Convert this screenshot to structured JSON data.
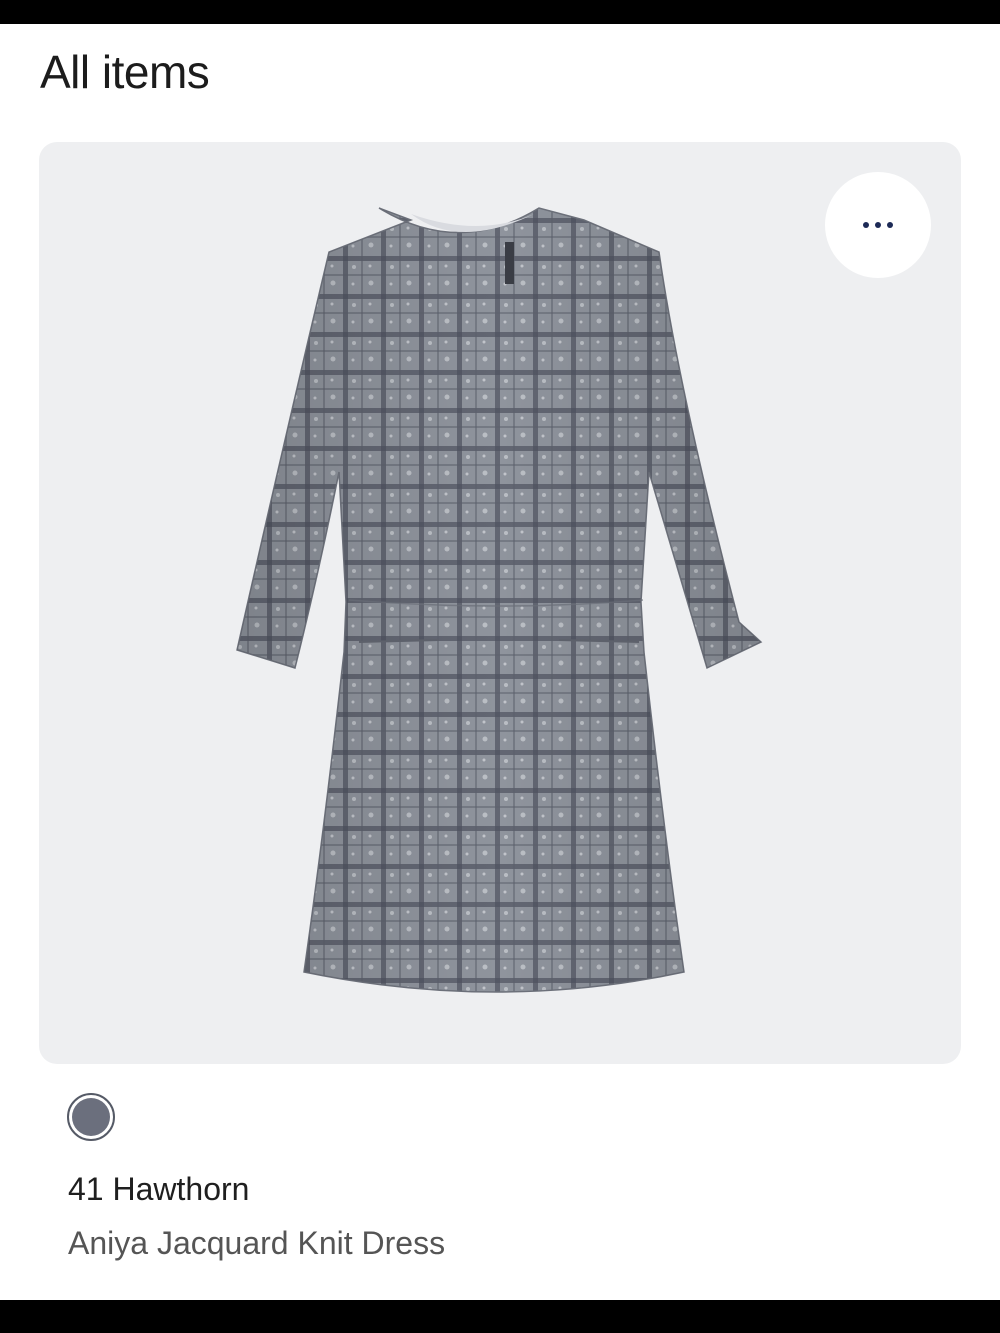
{
  "header": {
    "title": "All items"
  },
  "product": {
    "image_icon": "dress-image",
    "more_icon": "more-horizontal-icon",
    "swatch_color": "#6b6f7d",
    "brand": "41 Hawthorn",
    "name": "Aniya Jacquard Knit Dress"
  },
  "colors": {
    "card_background": "#eeeff1",
    "dots": "#1d2a56",
    "dress_base": "#8e939c"
  }
}
